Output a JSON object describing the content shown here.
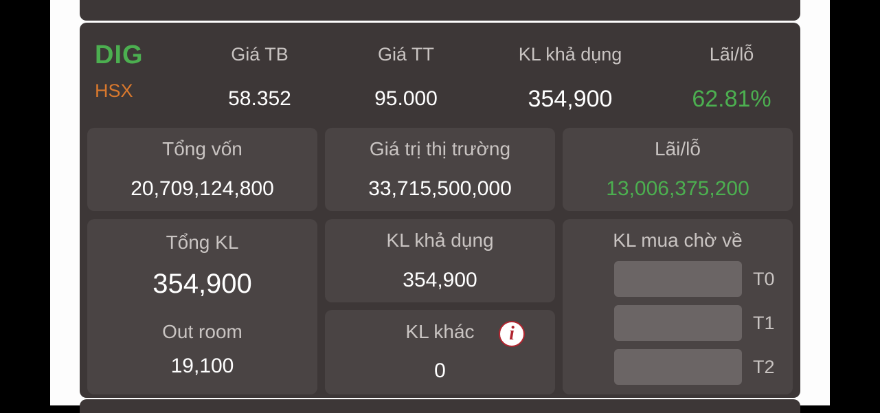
{
  "position": {
    "ticker": "DIG",
    "exchange": "HSX",
    "columns": [
      {
        "label": "Giá TB",
        "value": "58.352"
      },
      {
        "label": "Giá TT",
        "value": "95.000"
      },
      {
        "label": "KL khả dụng",
        "value": "354,900"
      },
      {
        "label": "Lãi/lỗ",
        "value": "62.81%"
      }
    ]
  },
  "summary": {
    "total_capital": {
      "label": "Tổng vốn",
      "value": "20,709,124,800"
    },
    "market_value": {
      "label": "Giá trị thị trường",
      "value": "33,715,500,000"
    },
    "profit_loss": {
      "label": "Lãi/lỗ",
      "value": "13,006,375,200"
    }
  },
  "volume": {
    "total": {
      "label": "Tổng KL",
      "value": "354,900"
    },
    "out_room": {
      "label": "Out room",
      "value": "19,100"
    },
    "available": {
      "label": "KL khả dụng",
      "value": "354,900"
    },
    "other": {
      "label": "KL khác",
      "value": "0",
      "icon": "info-icon"
    },
    "pending_buy": {
      "label": "KL mua chờ về",
      "slots": [
        {
          "label": "T0",
          "value": ""
        },
        {
          "label": "T1",
          "value": ""
        },
        {
          "label": "T2",
          "value": ""
        }
      ]
    }
  },
  "colors": {
    "card_bg": "#3d3737",
    "tile_bg": "#4a4444",
    "profit_green": "#4caf50",
    "exchange_orange": "#d9782d"
  }
}
